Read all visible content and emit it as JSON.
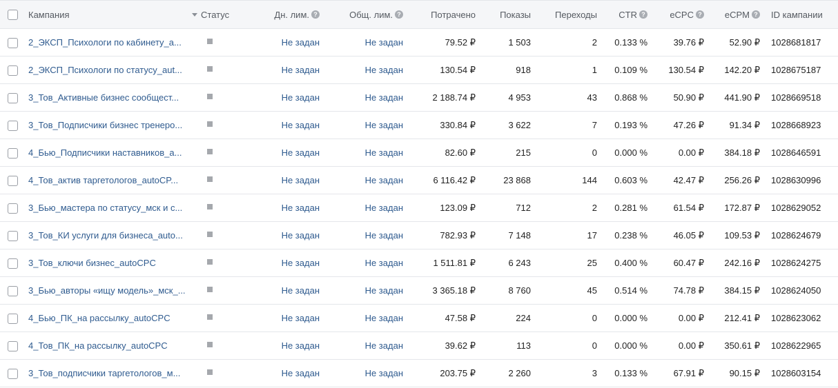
{
  "header": {
    "campaign": "Кампания",
    "status": "Статус",
    "day_limit": "Дн. лим.",
    "total_limit": "Общ. лим.",
    "spent": "Потрачено",
    "shows": "Показы",
    "clicks": "Переходы",
    "ctr": "CTR",
    "ecpc": "eCPC",
    "ecpm": "eCPM",
    "id": "ID кампании",
    "help_glyph": "?"
  },
  "status_color": "#a5a8ad",
  "link_color": "#2f5b8f",
  "rows": [
    {
      "name": "2_ЭКСП_Психологи по кабинету_a...",
      "day_limit": "Не задан",
      "total_limit": "Не задан",
      "spent": "79.52 ₽",
      "shows": "1 503",
      "clicks": "2",
      "ctr": "0.133 %",
      "ecpc": "39.76 ₽",
      "ecpm": "52.90 ₽",
      "id": "1028681817"
    },
    {
      "name": "2_ЭКСП_Психологи по статусу_aut...",
      "day_limit": "Не задан",
      "total_limit": "Не задан",
      "spent": "130.54 ₽",
      "shows": "918",
      "clicks": "1",
      "ctr": "0.109 %",
      "ecpc": "130.54 ₽",
      "ecpm": "142.20 ₽",
      "id": "1028675187"
    },
    {
      "name": "3_Тов_Активные бизнес сообщест...",
      "day_limit": "Не задан",
      "total_limit": "Не задан",
      "spent": "2 188.74 ₽",
      "shows": "4 953",
      "clicks": "43",
      "ctr": "0.868 %",
      "ecpc": "50.90 ₽",
      "ecpm": "441.90 ₽",
      "id": "1028669518"
    },
    {
      "name": "3_Тов_Подписчики бизнес тренеро...",
      "day_limit": "Не задан",
      "total_limit": "Не задан",
      "spent": "330.84 ₽",
      "shows": "3 622",
      "clicks": "7",
      "ctr": "0.193 %",
      "ecpc": "47.26 ₽",
      "ecpm": "91.34 ₽",
      "id": "1028668923"
    },
    {
      "name": "4_Бью_Подписчики наставников_a...",
      "day_limit": "Не задан",
      "total_limit": "Не задан",
      "spent": "82.60 ₽",
      "shows": "215",
      "clicks": "0",
      "ctr": "0.000 %",
      "ecpc": "0.00 ₽",
      "ecpm": "384.18 ₽",
      "id": "1028646591"
    },
    {
      "name": "4_Тов_актив таргетологов_autoCP...",
      "day_limit": "Не задан",
      "total_limit": "Не задан",
      "spent": "6 116.42 ₽",
      "shows": "23 868",
      "clicks": "144",
      "ctr": "0.603 %",
      "ecpc": "42.47 ₽",
      "ecpm": "256.26 ₽",
      "id": "1028630996"
    },
    {
      "name": "3_Бью_мастера по статусу_мск и с...",
      "day_limit": "Не задан",
      "total_limit": "Не задан",
      "spent": "123.09 ₽",
      "shows": "712",
      "clicks": "2",
      "ctr": "0.281 %",
      "ecpc": "61.54 ₽",
      "ecpm": "172.87 ₽",
      "id": "1028629052"
    },
    {
      "name": "3_Тов_КИ услуги для бизнеса_auto...",
      "day_limit": "Не задан",
      "total_limit": "Не задан",
      "spent": "782.93 ₽",
      "shows": "7 148",
      "clicks": "17",
      "ctr": "0.238 %",
      "ecpc": "46.05 ₽",
      "ecpm": "109.53 ₽",
      "id": "1028624679"
    },
    {
      "name": "3_Тов_ключи бизнес_autoCPC",
      "day_limit": "Не задан",
      "total_limit": "Не задан",
      "spent": "1 511.81 ₽",
      "shows": "6 243",
      "clicks": "25",
      "ctr": "0.400 %",
      "ecpc": "60.47 ₽",
      "ecpm": "242.16 ₽",
      "id": "1028624275"
    },
    {
      "name": "3_Бью_авторы «ищу модель»_мск_...",
      "day_limit": "Не задан",
      "total_limit": "Не задан",
      "spent": "3 365.18 ₽",
      "shows": "8 760",
      "clicks": "45",
      "ctr": "0.514 %",
      "ecpc": "74.78 ₽",
      "ecpm": "384.15 ₽",
      "id": "1028624050"
    },
    {
      "name": "4_Бью_ПК_на рассылку_autoCPC",
      "day_limit": "Не задан",
      "total_limit": "Не задан",
      "spent": "47.58 ₽",
      "shows": "224",
      "clicks": "0",
      "ctr": "0.000 %",
      "ecpc": "0.00 ₽",
      "ecpm": "212.41 ₽",
      "id": "1028623062"
    },
    {
      "name": "4_Тов_ПК_на рассылку_autoCPC",
      "day_limit": "Не задан",
      "total_limit": "Не задан",
      "spent": "39.62 ₽",
      "shows": "113",
      "clicks": "0",
      "ctr": "0.000 %",
      "ecpc": "0.00 ₽",
      "ecpm": "350.61 ₽",
      "id": "1028622965"
    },
    {
      "name": "3_Тов_подписчики таргетологов_м...",
      "day_limit": "Не задан",
      "total_limit": "Не задан",
      "spent": "203.75 ₽",
      "shows": "2 260",
      "clicks": "3",
      "ctr": "0.133 %",
      "ecpc": "67.91 ₽",
      "ecpm": "90.15 ₽",
      "id": "1028603154"
    }
  ]
}
